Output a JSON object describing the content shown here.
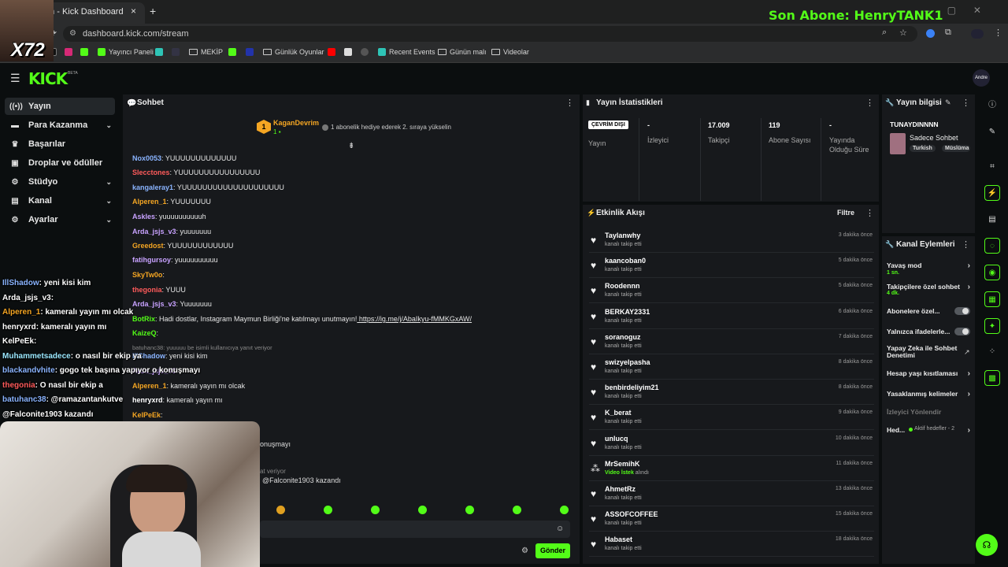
{
  "browser": {
    "tab_title": "m - Kick Dashboard",
    "close_icon": "×",
    "new_tab": "+",
    "url": "dashboard.kick.com/stream",
    "bookmarks": [
      {
        "label": "Yayıncı Paneli"
      },
      {
        "label": "MEKİP"
      },
      {
        "label": "Günlük Oyunlar"
      },
      {
        "label": "Recent Events"
      },
      {
        "label": "Günün malı"
      },
      {
        "label": "Videolar"
      }
    ]
  },
  "overlay": {
    "sub_banner": "Son Abone: HenryTANK1",
    "badge": "X72",
    "chat": [
      {
        "user": "IllShadow",
        "text": ": yeni kisi kim",
        "color": "#8ab4ff"
      },
      {
        "user": "Arda_jsjs_v3",
        "text": ":",
        "color": "#ffffff"
      },
      {
        "user": "Alperen_1",
        "text": ": kameralı yayın mı olcak",
        "color": "#f5a623"
      },
      {
        "user": "henryxrd",
        "text": ": kameralı yayın mı",
        "color": "#ffffff"
      },
      {
        "user": "KelPeEk",
        "text": ":",
        "color": "#ffffff"
      },
      {
        "user": "Muhammetsadece",
        "text": ": o nasıl bir ekip ya",
        "color": "#9be8ff"
      },
      {
        "user": "blackandvhite",
        "text": ": gogo tek başına yapıyor o konuşmayı",
        "color": "#8ab4ff"
      },
      {
        "user": "thegonia",
        "text": ": O nasıl bir ekip a",
        "color": "#ff5b5b"
      },
      {
        "user": "batuhanc38",
        "text": ": @ramazantankutve",
        "color": "#8ab4ff"
      },
      {
        "user": "",
        "text": "@Falconite1903 kazandı",
        "color": "#ffffff"
      }
    ]
  },
  "kick": {
    "logo": "KICK",
    "beta": "BETA",
    "avatar": "Andre"
  },
  "sidebar": {
    "items": [
      {
        "label": "Yayın",
        "icon": "broadcast-icon"
      },
      {
        "label": "Para Kazanma",
        "icon": "money-icon",
        "chevron": "⌄"
      },
      {
        "label": "Başarılar",
        "icon": "trophy-icon"
      },
      {
        "label": "Droplar ve ödüller",
        "icon": "gift-icon"
      },
      {
        "label": "Stüdyo",
        "icon": "studio-icon",
        "chevron": "⌄"
      },
      {
        "label": "Kanal",
        "icon": "channel-icon",
        "chevron": "⌄"
      },
      {
        "label": "Ayarlar",
        "icon": "gear-icon",
        "chevron": "⌄"
      }
    ]
  },
  "chat": {
    "title": "Sohbet",
    "pinned_user": "KaganDevrim",
    "pinned_rank": "1",
    "pinned_count": "1",
    "pinned_text": "1 abonelik hediye ederek 2. sıraya yükselin",
    "messages": [
      {
        "user": "Nox0053",
        "text": ": YUUUUUUUUUUUUU",
        "color": "#8ab4ff"
      },
      {
        "user": "Slecctones",
        "text": ": YUUUUUUUUUUUUUUUU",
        "color": "#ff5b5b"
      },
      {
        "user": "kangaleray1",
        "text": ": YUUUUUUUUUUUUUUUUUUUU",
        "color": "#8ab4ff"
      },
      {
        "user": "Alperen_1",
        "text": ": YUUUUUUU",
        "color": "#f5a623"
      },
      {
        "user": "Askles",
        "text": ": yuuuuuuuuuuh",
        "color": "#c8a2ff"
      },
      {
        "user": "Arda_jsjs_v3",
        "text": ": yuuuuuuu",
        "color": "#c8a2ff"
      },
      {
        "user": "Greedost",
        "text": ": YUUUUUUUUUUUU",
        "color": "#f5a623"
      },
      {
        "user": "fatihgursoy",
        "text": ": yuuuuuuuuuu",
        "color": "#c8a2ff"
      },
      {
        "user": "SkyTw0o",
        "text": ":",
        "color": "#f5a623"
      },
      {
        "user": "thegonia",
        "text": ": YUUU",
        "color": "#ff5b5b"
      },
      {
        "user": "Arda_jsjs_v3",
        "text": ": Yuuuuuuu",
        "color": "#c8a2ff"
      },
      {
        "user": "BotRix",
        "text": ": Hadi dostlar, Instagram Maymun Birliği'ne katılmayı unutmayın!",
        "link": "https://ig.me/j/AbaIkyu-fMMKGxAW/",
        "color": "#53fc18"
      },
      {
        "user": "KaizeQ",
        "text": ":",
        "color": "#53fc18"
      },
      {
        "user": "",
        "text": "batuhanc38: yuuuuu be isimli kullanıcıya yanıt veriyor",
        "color": "#888888"
      },
      {
        "user": "IllShadow",
        "text": ": yeni kisi kim",
        "color": "#8ab4ff"
      },
      {
        "user": "Arda_jsjs_v3",
        "text": ":",
        "color": "#c8a2ff"
      },
      {
        "user": "Alperen_1",
        "text": ": kameralı yayın mı olcak",
        "color": "#f5a623"
      },
      {
        "user": "henryxrd",
        "text": ": kameralı yayın mı",
        "color": "#ffffff"
      },
      {
        "user": "KelPeEk",
        "text": ":",
        "color": "#f5a623"
      }
    ],
    "partial_1": "onuşmayı",
    "partial_2": "at veriyor",
    "partial_3": "@Falconite1903 kazandı",
    "send_button": "Gönder"
  },
  "stats": {
    "title": "Yayın İstatistikleri",
    "status_badge": "ÇEVRİM DIŞI",
    "columns": [
      {
        "value": "",
        "label": "Yayın"
      },
      {
        "value": "-",
        "label": "İzleyici"
      },
      {
        "value": "17.009",
        "label": "Takipçi"
      },
      {
        "value": "119",
        "label": "Abone Sayısı"
      },
      {
        "value": "-",
        "label": "Yayında Olduğu Süre"
      }
    ]
  },
  "stream_info": {
    "title": "Yayın bilgisi",
    "channel": "TUNAYDINNNN",
    "mode": "Sadece Sohbet",
    "tags": [
      "Turkish",
      "Müslüma"
    ]
  },
  "activity": {
    "title": "Etkinlik Akışı",
    "filter": "Filtre",
    "items": [
      {
        "name": "Taylanwhy",
        "sub": "kanalı takip etti",
        "time": "3 dakika önce"
      },
      {
        "name": "kaancoban0",
        "sub": "kanalı takip etti",
        "time": "5 dakika önce"
      },
      {
        "name": "Roodennn",
        "sub": "kanalı takip etti",
        "time": "5 dakika önce"
      },
      {
        "name": "BERKAY2331",
        "sub": "kanalı takip etti",
        "time": "6 dakika önce"
      },
      {
        "name": "soranoguz",
        "sub": "kanalı takip etti",
        "time": "7 dakika önce"
      },
      {
        "name": "swizyelpasha",
        "sub": "kanalı takip etti",
        "time": "8 dakika önce"
      },
      {
        "name": "benbirdeliyim21",
        "sub": "kanalı takip etti",
        "time": "8 dakika önce"
      },
      {
        "name": "K_berat",
        "sub": "kanalı takip etti",
        "time": "9 dakika önce"
      },
      {
        "name": "unlucq",
        "sub": "kanalı takip etti",
        "time": "10 dakika önce"
      },
      {
        "name": "MrSemihK",
        "sub_highlight": "Video İstek",
        "sub": "alındı",
        "time": "11 dakika önce"
      },
      {
        "name": "AhmetRz",
        "sub": "kanalı takip etti",
        "time": "13 dakika önce"
      },
      {
        "name": "ASSOFCOFFEE",
        "sub": "kanalı takip etti",
        "time": "15 dakika önce"
      },
      {
        "name": "Habaset",
        "sub": "kanalı takip etti",
        "time": "18 dakika önce"
      }
    ]
  },
  "actions": {
    "title": "Kanal Eylemleri",
    "slow_mode": "Yavaş mod",
    "slow_mode_val": "1 sn.",
    "followers_only": "Takipçilere özel sohbet",
    "followers_only_val": "4 dk.",
    "subscribers": "Abonelere özel...",
    "emotes_only": "Yalnızca ifadelerle...",
    "ai_moderation": "Yapay Zeka ile Sohbet Denetimi",
    "account_age": "Hesap yaşı kısıtlaması",
    "banned_words": "Yasaklanmış kelimeler",
    "viewer_redirect": "İzleyici Yönlendir",
    "goals": "Hed...",
    "goals_sub": "Aktif hedefler - 2"
  }
}
